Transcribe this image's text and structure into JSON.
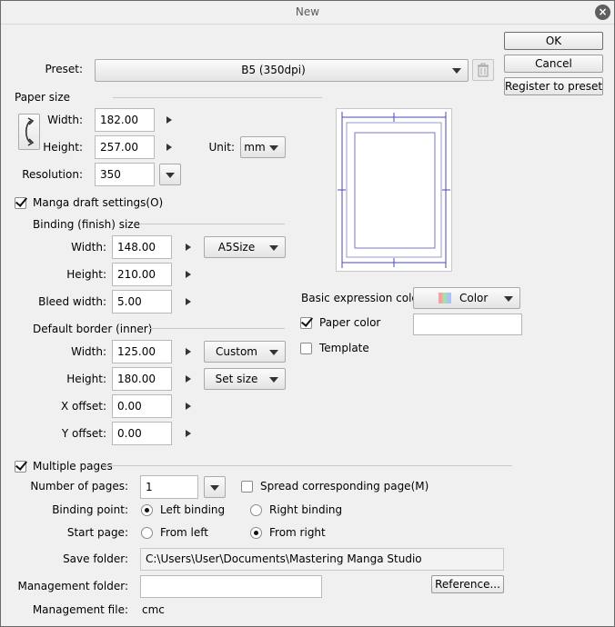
{
  "window": {
    "title": "New"
  },
  "buttons": {
    "ok": "OK",
    "cancel": "Cancel",
    "register": "Register to preset",
    "reference": "Reference..."
  },
  "preset": {
    "label": "Preset:",
    "value": "B5 (350dpi)"
  },
  "paper_size": {
    "header": "Paper size",
    "width_label": "Width:",
    "width_value": "182.00",
    "height_label": "Height:",
    "height_value": "257.00",
    "unit_label": "Unit:",
    "unit_value": "mm",
    "resolution_label": "Resolution:",
    "resolution_value": "350"
  },
  "manga": {
    "label": "Manga draft settings(O)",
    "checked": true,
    "binding_header": "Binding (finish) size",
    "bind_width_label": "Width:",
    "bind_width_value": "148.00",
    "bind_size_preset": "A5Size",
    "bind_height_label": "Height:",
    "bind_height_value": "210.00",
    "bleed_label": "Bleed width:",
    "bleed_value": "5.00",
    "border_header": "Default border (inner)",
    "border_width_label": "Width:",
    "border_width_value": "125.00",
    "border_width_preset": "Custom",
    "border_height_label": "Height:",
    "border_height_value": "180.00",
    "border_height_preset": "Set size",
    "xoffset_label": "X offset:",
    "xoffset_value": "0.00",
    "yoffset_label": "Y offset:",
    "yoffset_value": "0.00"
  },
  "color": {
    "basic_label": "Basic expression color:",
    "basic_value": "Color",
    "paper_color_label": "Paper color",
    "paper_color_checked": true,
    "template_label": "Template",
    "template_checked": false
  },
  "pages": {
    "multiple_label": "Multiple pages",
    "multiple_checked": true,
    "number_label": "Number of pages:",
    "number_value": "1",
    "spread_label": "Spread corresponding page(M)",
    "spread_checked": false,
    "binding_point_label": "Binding point:",
    "left_binding": "Left binding",
    "right_binding": "Right binding",
    "binding_selected": "left",
    "start_page_label": "Start page:",
    "from_left": "From left",
    "from_right": "From right",
    "start_selected": "right",
    "save_folder_label": "Save folder:",
    "save_folder_value": "C:\\Users\\User\\Documents\\Mastering Manga Studio",
    "management_folder_label": "Management folder:",
    "management_folder_value": "",
    "management_file_label": "Management file:",
    "management_file_value": "cmc"
  },
  "icons": {
    "close": "close-icon",
    "trash": "trash-icon",
    "rotate": "rotate-orientation-icon",
    "palette": "color-swatch-icon"
  },
  "colors": {
    "border_line": "#4a4ab5",
    "title_text": "#5a5a5a"
  }
}
